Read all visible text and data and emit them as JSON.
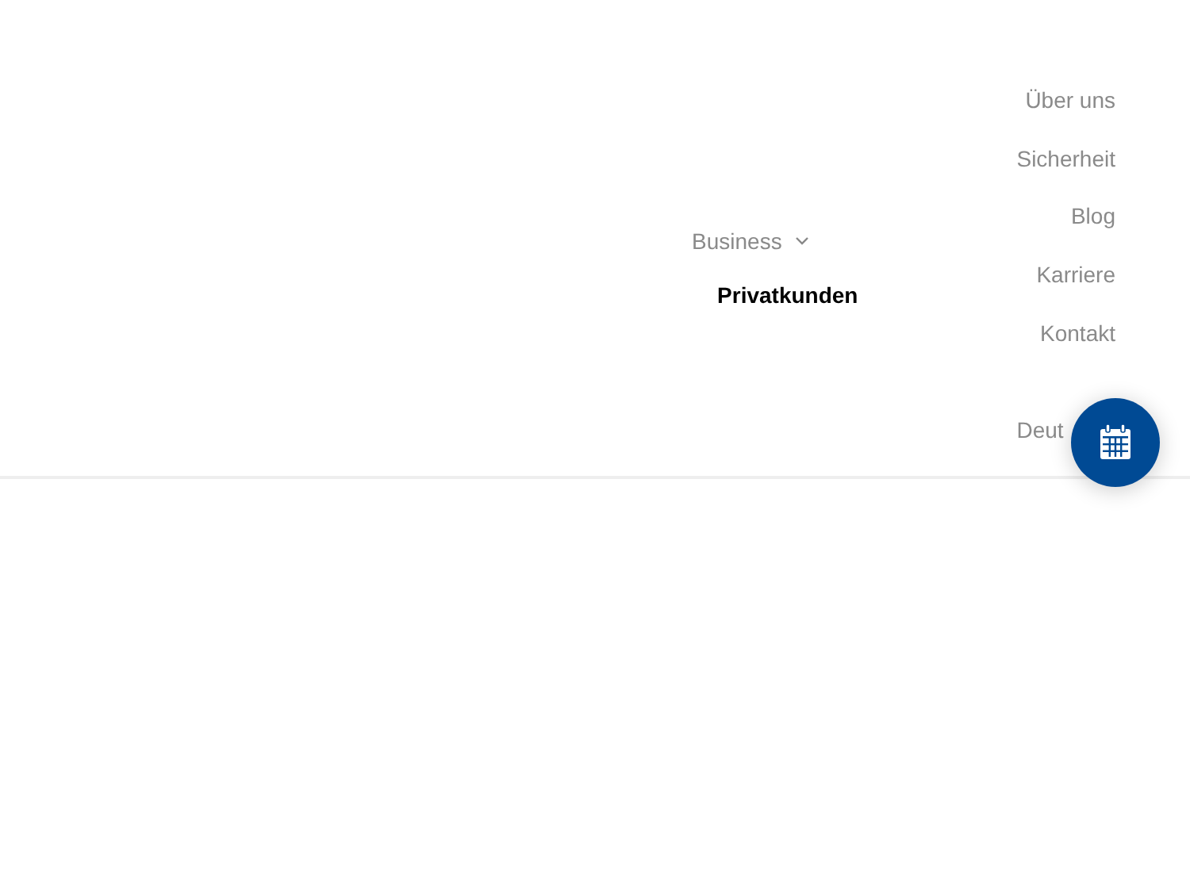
{
  "main_nav": [
    {
      "label": "Business",
      "selected": false,
      "has_dropdown": true
    },
    {
      "label": "Privatkunden",
      "selected": true,
      "has_dropdown": false
    }
  ],
  "secondary_nav": [
    {
      "label": "Über uns"
    },
    {
      "label": "Sicherheit"
    },
    {
      "label": "Blog"
    },
    {
      "label": "Karriere"
    },
    {
      "label": "Kontakt"
    }
  ],
  "language": {
    "label": "Deut"
  },
  "calendar_button": {
    "kind": "calendar"
  }
}
